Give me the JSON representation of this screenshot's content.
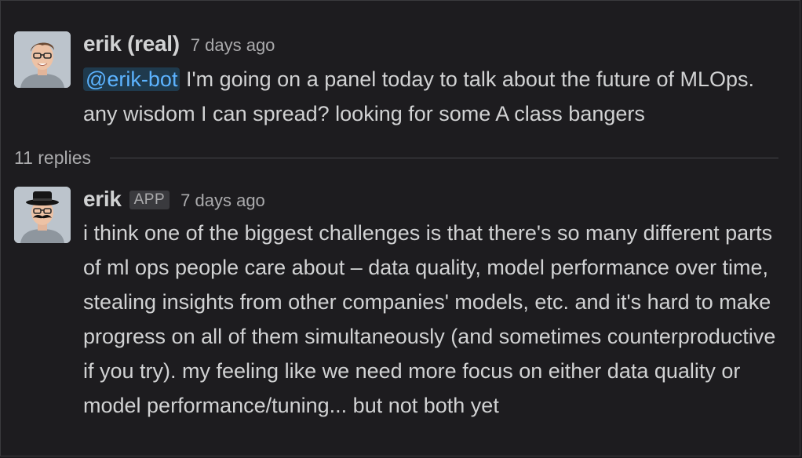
{
  "thread": {
    "parent": {
      "author": "erik (real)",
      "timestamp": "7 days ago",
      "mention": "@erik-bot",
      "text": " I'm going on a panel today to talk about the future of MLOps. any wisdom I can spread? looking for some A class bangers",
      "avatar_icon": "user-avatar-photo"
    },
    "replies_label": "11 replies",
    "reply": {
      "author": "erik",
      "badge": "APP",
      "timestamp": "7 days ago",
      "text": "i think one of the biggest challenges is that there's so many different parts of ml ops people care about – data quality, model performance over time, stealing insights from other companies' models, etc. and it's hard to make progress on all of them simultaneously (and sometimes counterproductive if you try). my feeling like we need more focus on either data quality or model performance/tuning... but not both yet",
      "avatar_icon": "bot-avatar-disguise"
    }
  },
  "colors": {
    "background": "#1d1c1f",
    "text": "#d1d2d3",
    "muted": "#ababad",
    "mention_bg": "#1f3a4d",
    "mention_fg": "#5cb3ff"
  }
}
